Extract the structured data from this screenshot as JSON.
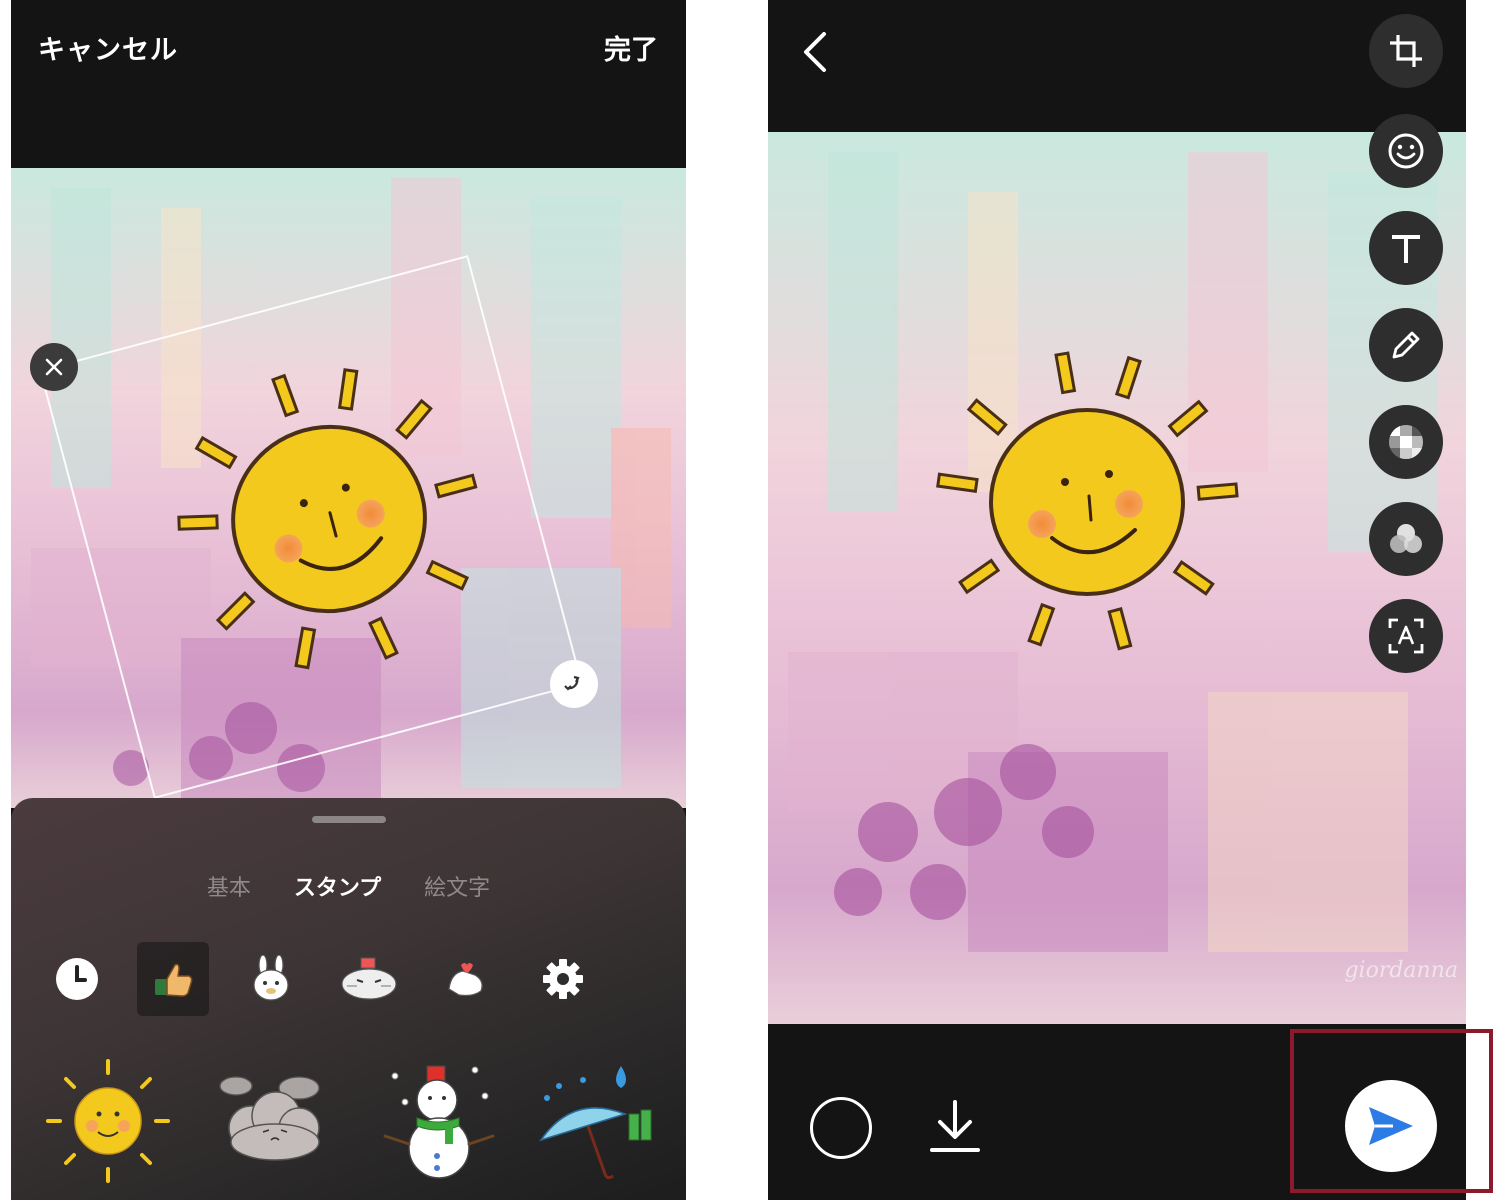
{
  "left_screen": {
    "header": {
      "cancel_label": "キャンセル",
      "done_label": "完了"
    },
    "sticker_panel": {
      "tabs": [
        {
          "label": "基本",
          "active": false
        },
        {
          "label": "スタンプ",
          "active": true
        },
        {
          "label": "絵文字",
          "active": false
        }
      ],
      "categories": [
        {
          "icon": "recent-clock-icon",
          "active": false
        },
        {
          "icon": "thumbs-up-sticker-pack",
          "active": true
        },
        {
          "icon": "rabbit-sticker-pack",
          "active": false
        },
        {
          "icon": "cat-sticker-pack",
          "active": false
        },
        {
          "icon": "finger-heart-sticker-pack",
          "active": false
        },
        {
          "icon": "settings-gear-icon",
          "active": false
        }
      ],
      "stickers": [
        "sun-sticker",
        "cloud-sticker",
        "snowman-sticker",
        "umbrella-rain-sticker"
      ]
    }
  },
  "right_screen": {
    "tools": [
      "crop-icon",
      "sticker-smiley-icon",
      "text-icon",
      "pen-icon",
      "mosaic-icon",
      "filter-icon",
      "text-recognition-icon"
    ],
    "signature": "giordanna",
    "send_color": "#2d7be5"
  },
  "colors": {
    "background_dark": "#141414",
    "highlight_border": "#8a1a2c",
    "sun_yellow": "#f4c91e"
  }
}
